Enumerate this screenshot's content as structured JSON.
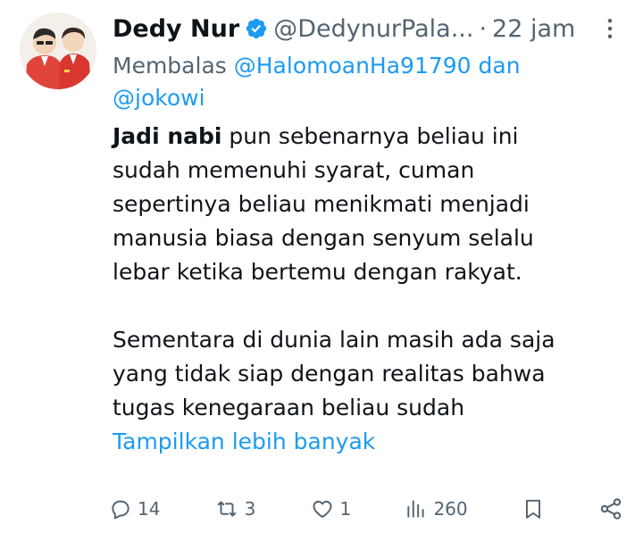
{
  "author": {
    "name": "Dedy Nur",
    "handle": "@DedynurPala...",
    "separator": "·",
    "time": "22 jam"
  },
  "reply": {
    "prefix": "Membalas",
    "mention_1": "@HalomoanHa91790",
    "connector": "dan",
    "mention_2": "@jokowi"
  },
  "tweet": {
    "bold_start": "Jadi nabi",
    "para1_rest_lines": [
      " pun sebenarnya beliau ini",
      "sudah memenuhi syarat, cuman",
      "sepertinya beliau menikmati menjadi",
      "manusia biasa dengan senyum selalu",
      "lebar ketika bertemu dengan rakyat."
    ],
    "para2_lines": [
      "Sementara di dunia lain masih ada saja",
      "yang tidak siap dengan realitas bahwa",
      "tugas kenegaraan beliau sudah"
    ],
    "show_more": "Tampilkan lebih banyak"
  },
  "actions": {
    "replies": "14",
    "retweets": "3",
    "likes": "1",
    "views": "260"
  },
  "colors": {
    "text": "#0f1419",
    "secondary": "#536471",
    "link": "#1d9bf0",
    "verified": "#1d9bf0"
  },
  "icons": [
    "verified-badge-icon",
    "more-icon",
    "reply-icon",
    "retweet-icon",
    "like-icon",
    "views-icon",
    "bookmark-icon",
    "share-icon"
  ]
}
